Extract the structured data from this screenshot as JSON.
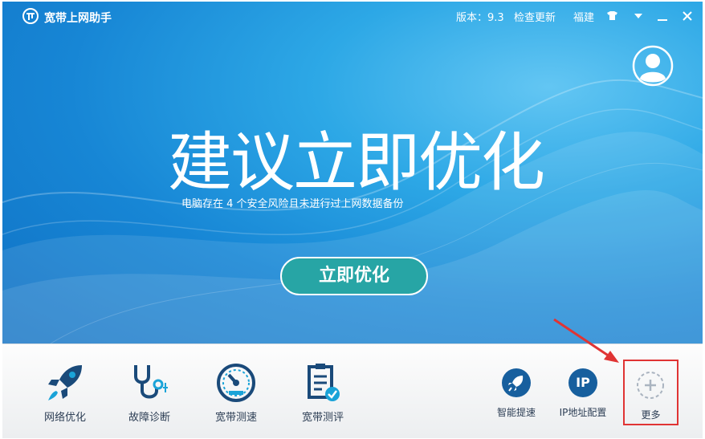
{
  "app": {
    "title": "宽带上网助手",
    "version": "版本：9.3",
    "check_update": "检查更新",
    "region": "福建"
  },
  "icons": {
    "logo": "broadband-logo-icon",
    "skin": "tshirt-skin-icon",
    "menu": "dropdown-triangle-icon",
    "minimize": "minimize-icon",
    "close": "close-icon",
    "avatar": "user-avatar-icon"
  },
  "hero": {
    "headline": "建议立即优化",
    "subline": "电脑存在 4 个安全风险且未进行过上网数据备份",
    "button": "立即优化"
  },
  "tools": [
    {
      "label": "网络优化",
      "icon": "rocket-icon"
    },
    {
      "label": "故障诊断",
      "icon": "stethoscope-icon"
    },
    {
      "label": "宽带测速",
      "icon": "speedometer-icon"
    },
    {
      "label": "宽带测评",
      "icon": "clipboard-check-icon"
    }
  ],
  "small_tools": [
    {
      "label": "智能提速",
      "icon": "rocket-circle-icon"
    },
    {
      "label": "IP地址配置",
      "icon": "ip-circle-icon",
      "glyph": "IP"
    }
  ],
  "more": {
    "label": "更多",
    "icon": "plus-circle-icon"
  },
  "colors": {
    "hero_blue": "#1b8ad6",
    "button_teal": "#27a5a5",
    "icon_navy": "#1a4a7a",
    "icon_cyan": "#1aa3d8",
    "highlight_red": "#e03434"
  }
}
